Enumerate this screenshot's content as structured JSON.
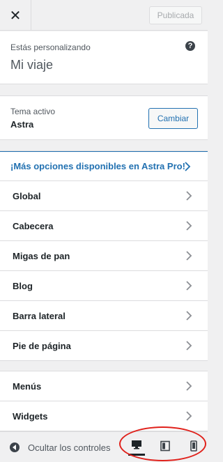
{
  "header": {
    "close_symbol": "✕",
    "publish_label": "Publicada"
  },
  "info": {
    "label": "Estás personalizando",
    "title": "Mi viaje",
    "help_symbol": "?"
  },
  "theme": {
    "label": "Tema activo",
    "name": "Astra",
    "change_label": "Cambiar"
  },
  "promo": {
    "label": "¡Más opciones disponibles en Astra Pro!"
  },
  "sections": [
    {
      "label": "Global"
    },
    {
      "label": "Cabecera"
    },
    {
      "label": "Migas de pan"
    },
    {
      "label": "Blog"
    },
    {
      "label": "Barra lateral"
    },
    {
      "label": "Pie de página"
    }
  ],
  "sections2": [
    {
      "label": "Menús"
    },
    {
      "label": "Widgets"
    }
  ],
  "footer": {
    "collapse_label": "Ocultar los controles",
    "devices": [
      {
        "icon": "desktop-icon",
        "active": true
      },
      {
        "icon": "tablet-icon",
        "active": false
      },
      {
        "icon": "mobile-icon",
        "active": false
      }
    ]
  },
  "colors": {
    "accent": "#2271b1",
    "highlight": "#e0211b"
  }
}
